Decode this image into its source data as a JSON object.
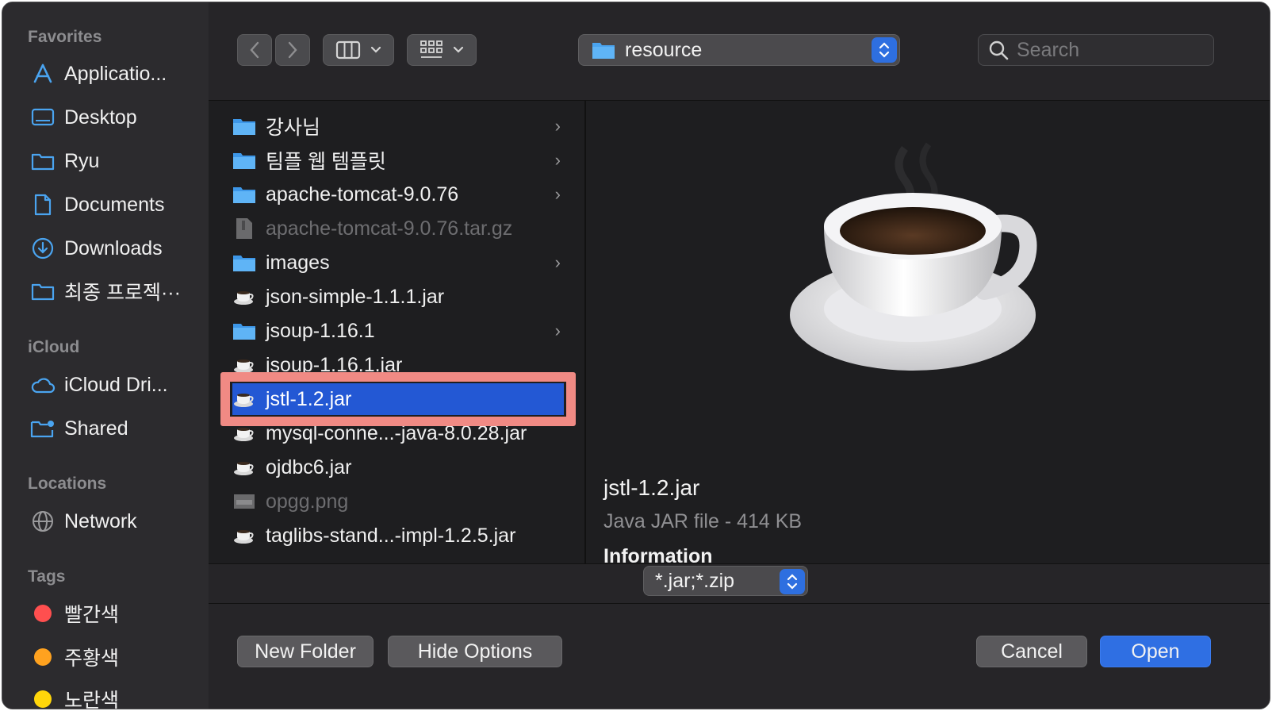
{
  "sidebar": {
    "favorites_title": "Favorites",
    "favorites": [
      {
        "label": "Applicatio...",
        "icon": "applications-icon"
      },
      {
        "label": "Desktop",
        "icon": "desktop-icon"
      },
      {
        "label": "Ryu",
        "icon": "folder-icon"
      },
      {
        "label": "Documents",
        "icon": "document-icon"
      },
      {
        "label": "Downloads",
        "icon": "downloads-icon"
      },
      {
        "label": "최종 프로젝···",
        "icon": "folder-icon"
      }
    ],
    "icloud_title": "iCloud",
    "icloud": [
      {
        "label": "iCloud Dri...",
        "icon": "cloud-icon"
      },
      {
        "label": "Shared",
        "icon": "shared-folder-icon"
      }
    ],
    "locations_title": "Locations",
    "locations": [
      {
        "label": "Network",
        "icon": "network-icon"
      }
    ],
    "tags_title": "Tags",
    "tags": [
      {
        "label": "빨간색",
        "color": "#ff4f4f"
      },
      {
        "label": "주황색",
        "color": "#ffa21f"
      },
      {
        "label": "노란색",
        "color": "#ffd60a"
      }
    ]
  },
  "toolbar": {
    "location": "resource",
    "search_placeholder": "Search"
  },
  "files": [
    {
      "name": "강사님",
      "kind": "folder",
      "has_children": true,
      "dim": false
    },
    {
      "name": "팀플 웹 템플릿",
      "kind": "folder",
      "has_children": true,
      "dim": false
    },
    {
      "name": "apache-tomcat-9.0.76",
      "kind": "folder",
      "has_children": true,
      "dim": false
    },
    {
      "name": "apache-tomcat-9.0.76.tar.gz",
      "kind": "archive",
      "has_children": false,
      "dim": true
    },
    {
      "name": "images",
      "kind": "folder",
      "has_children": true,
      "dim": false
    },
    {
      "name": "json-simple-1.1.1.jar",
      "kind": "jar",
      "has_children": false,
      "dim": false
    },
    {
      "name": "jsoup-1.16.1",
      "kind": "folder",
      "has_children": true,
      "dim": false
    },
    {
      "name": "jsoup-1.16.1.jar",
      "kind": "jar",
      "has_children": false,
      "dim": false
    },
    {
      "name": "jstl-1.2.jar",
      "kind": "jar",
      "has_children": false,
      "dim": false,
      "selected": true
    },
    {
      "name": "mysql-conne...-java-8.0.28.jar",
      "kind": "jar",
      "has_children": false,
      "dim": false
    },
    {
      "name": "ojdbc6.jar",
      "kind": "jar",
      "has_children": false,
      "dim": false
    },
    {
      "name": "opgg.png",
      "kind": "image",
      "has_children": false,
      "dim": true
    },
    {
      "name": "taglibs-stand...-impl-1.2.5.jar",
      "kind": "jar",
      "has_children": false,
      "dim": false
    }
  ],
  "preview": {
    "name": "jstl-1.2.jar",
    "kind": "Java JAR file - 414 KB",
    "info_title": "Information"
  },
  "format": {
    "value": "*.jar;*.zip"
  },
  "buttons": {
    "new_folder": "New Folder",
    "hide_options": "Hide Options",
    "cancel": "Cancel",
    "open": "Open"
  },
  "colors": {
    "accent": "#2f6fe3",
    "selection": "#2358d4",
    "highlight_box": "#f08a84",
    "folder": "#4aa4f0"
  }
}
